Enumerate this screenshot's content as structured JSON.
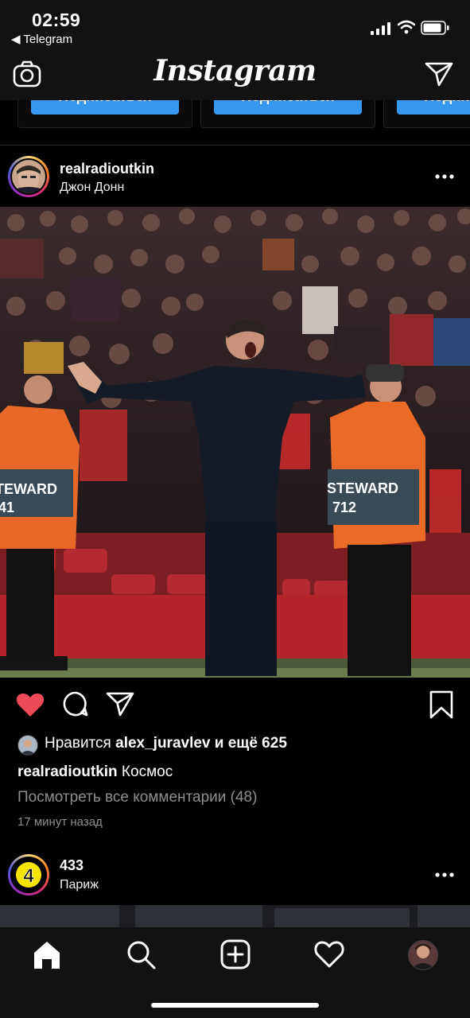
{
  "status_bar": {
    "time": "02:59",
    "back_app": "◀ Telegram"
  },
  "nav": {
    "logo": "Instagram",
    "left_icon": "camera-icon",
    "right_icon": "direct-send-icon"
  },
  "suggestions": {
    "button_label": "Подписаться"
  },
  "post": {
    "username": "realradioutkin",
    "location": "Джон Донн",
    "liked": true,
    "likes_prefix": "Нравится ",
    "likes_user": "alex_juravlev",
    "likes_suffix": " и ещё 625",
    "caption_user": "realradioutkin",
    "caption_text": " Космос",
    "view_comments": "Посмотреть все комментарии (48)",
    "time_ago": "17 минут назад",
    "photo_text": {
      "vest_left": "TEWARD",
      "vest_left_num": "41",
      "vest_right": "STEWARD",
      "vest_right_num": "712"
    }
  },
  "next_post": {
    "username": "433",
    "location": "Париж",
    "avatar_text": "4"
  },
  "tab_bar": {
    "tabs": [
      "home-icon",
      "search-icon",
      "new-post-icon",
      "activity-heart-icon",
      "profile-avatar"
    ]
  },
  "colors": {
    "like_red": "#ed4956",
    "button_blue": "#3897f0",
    "background": "#000000",
    "bar_background": "#121212",
    "muted_text": "#8e8e8e"
  }
}
